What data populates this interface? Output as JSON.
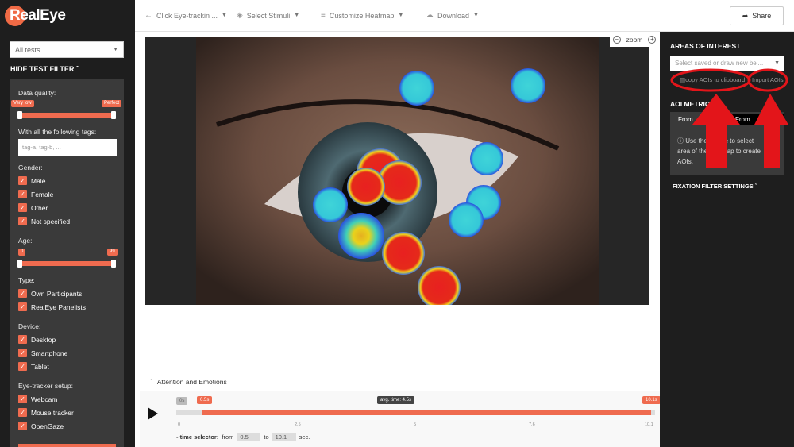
{
  "app": {
    "logo": "RealEye"
  },
  "toolbar": {
    "test_name": "Click Eye-trackin ...",
    "select_stimuli": "Select Stimuli",
    "customize_heatmap": "Customize Heatmap",
    "download": "Download",
    "share": "Share"
  },
  "sidebar": {
    "tests_select": "All tests",
    "hide_filter": "HIDE TEST FILTER",
    "data_quality": {
      "label": "Data quality:",
      "min_label": "Very low",
      "max_label": "Perfect"
    },
    "tags": {
      "label": "With all the following tags:",
      "placeholder": "tag-a, tag-b, ..."
    },
    "gender": {
      "label": "Gender:",
      "options": [
        {
          "label": "Male",
          "checked": true
        },
        {
          "label": "Female",
          "checked": true
        },
        {
          "label": "Other",
          "checked": true
        },
        {
          "label": "Not specified",
          "checked": true
        }
      ]
    },
    "age": {
      "label": "Age:",
      "min": "0",
      "max": "99"
    },
    "type": {
      "label": "Type:",
      "options": [
        {
          "label": "Own Participants",
          "checked": true
        },
        {
          "label": "RealEye Panelists",
          "checked": true
        }
      ]
    },
    "device": {
      "label": "Device:",
      "options": [
        {
          "label": "Desktop",
          "checked": true
        },
        {
          "label": "Smartphone",
          "checked": true
        },
        {
          "label": "Tablet",
          "checked": true
        }
      ]
    },
    "setup": {
      "label": "Eye-tracker setup:",
      "options": [
        {
          "label": "Webcam",
          "checked": true
        },
        {
          "label": "Mouse tracker",
          "checked": true
        },
        {
          "label": "OpenGaze",
          "checked": true
        }
      ]
    }
  },
  "zoom": {
    "label": "zoom"
  },
  "timeline": {
    "tab": "Attention and Emotions",
    "start_flag": "0.5s",
    "avg_flag": "avg. time: 4.5s",
    "end_flag": "10.1s",
    "ticks": [
      "0",
      "2.5",
      "5",
      "7.6",
      "10.1"
    ],
    "selector_label": "- time selector:",
    "from_label": "from",
    "from_value": "0.5",
    "to_label": "to",
    "to_value": "10.1",
    "unit": "sec.",
    "zero_box": "0s"
  },
  "rpanel": {
    "aoi_title": "AREAS OF INTEREST",
    "aoi_placeholder": "Select saved or draw new bel...",
    "copy_aois": "copy AOIs to clipboard",
    "import_aois": "Import AOIs",
    "metrics_title": "AOI METRICS",
    "seg_left": "From",
    "seg_right": "From",
    "info": "Use the mouse to select an area of the heatmap to create AOIs.",
    "info_line1": "Use the mouse to select",
    "info_line2": "area of the heatmap to create",
    "info_line3": "AOIs.",
    "fixation": "FIXATION FILTER SETTINGS"
  },
  "colors": {
    "accent": "#ef6b4f",
    "dark": "#1e1e1e",
    "annotation": "#e3151a"
  }
}
